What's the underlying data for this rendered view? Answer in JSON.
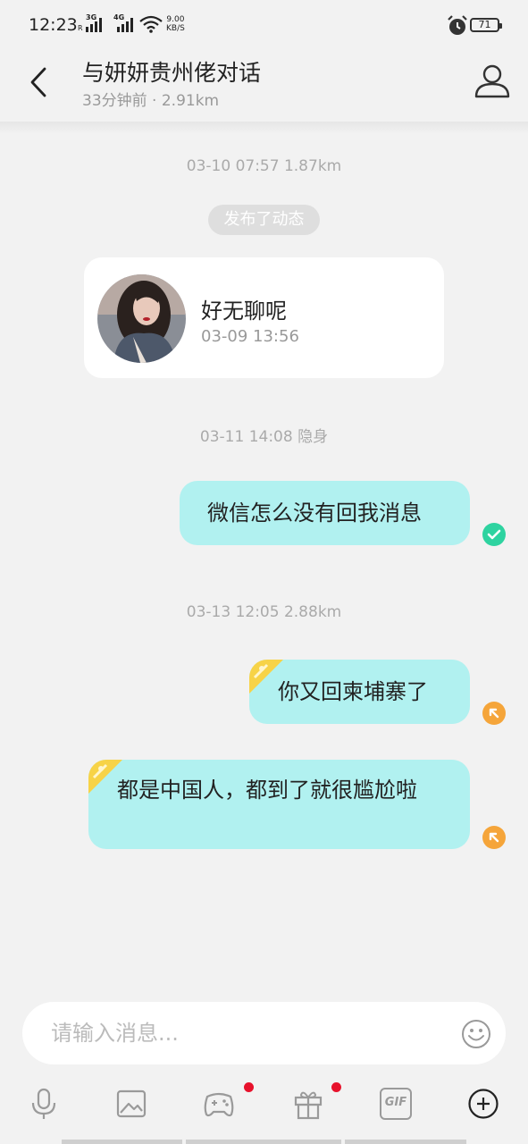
{
  "status_bar": {
    "time": "12:23",
    "signal_1_type": "3G",
    "signal_1_sub": "R",
    "signal_2_type": "4G",
    "speed_value": "9.00",
    "speed_unit": "KB/S",
    "battery": "71"
  },
  "header": {
    "title": "与妍妍贵州佬对话",
    "subtitle": "33分钟前 · 2.91km",
    "back_icon": "chevron-left-icon",
    "profile_icon": "user-icon"
  },
  "messages": {
    "time_1": "03-10 07:57  1.87km",
    "moment_label": "发布了动态",
    "moment": {
      "text": "好无聊呢",
      "time": "03-09 13:56"
    },
    "time_2": "03-11 14:08  隐身",
    "msg_1": "微信怎么没有回我消息",
    "time_3": "03-13 12:05  2.88km",
    "msg_2": "你又回柬埔寨了",
    "msg_3": "都是中国人，都到了就很尴尬啦"
  },
  "input": {
    "placeholder": "请输入消息..."
  },
  "toolbar": {
    "items": [
      "mic-icon",
      "image-icon",
      "gamepad-icon",
      "gift-icon",
      "gif-icon",
      "add-circle-icon"
    ],
    "gif_label": "GIF"
  },
  "colors": {
    "bubble": "#b1f1f0",
    "sent_ok": "#2ed3a0",
    "unread": "#f5a53a",
    "badge": "#e7122c"
  }
}
